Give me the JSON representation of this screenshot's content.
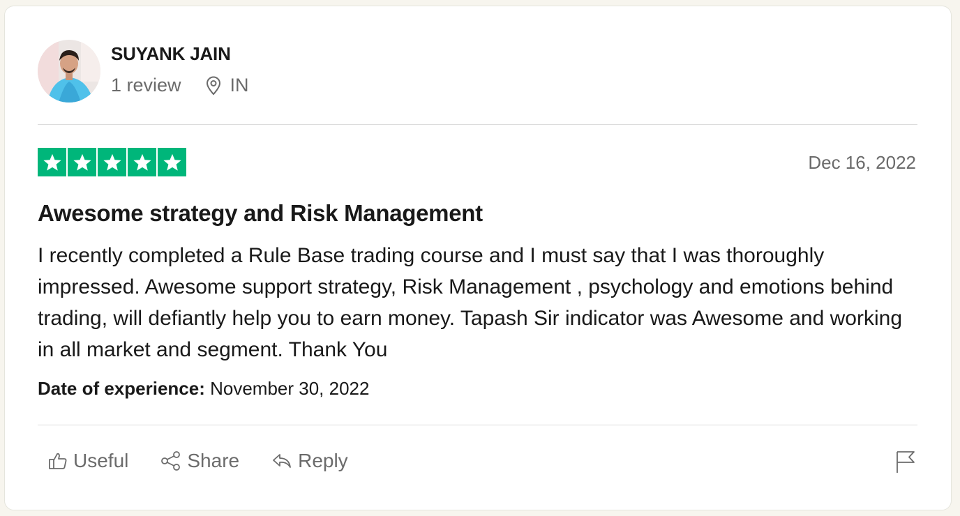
{
  "reviewer": {
    "name": "SUYANK JAIN",
    "review_count": "1 review",
    "location": "IN",
    "avatar_icon": "profile-photo"
  },
  "rating": {
    "stars": 5,
    "max": 5,
    "color": "#00b67a"
  },
  "review": {
    "date": "Dec 16, 2022",
    "title": "Awesome strategy and Risk Management",
    "body": "I recently completed a Rule Base trading course and I must say that I was thoroughly impressed. Awesome support strategy, Risk Management , psychology and emotions behind trading, will defiantly help you to earn money. Tapash Sir indicator was Awesome and working in all market and segment. Thank You",
    "experience_label": "Date of experience:",
    "experience_date": "November 30, 2022"
  },
  "actions": {
    "useful": "Useful",
    "share": "Share",
    "reply": "Reply",
    "useful_icon": "thumbs-up-icon",
    "share_icon": "share-icon",
    "reply_icon": "reply-icon",
    "flag_icon": "flag-icon"
  }
}
